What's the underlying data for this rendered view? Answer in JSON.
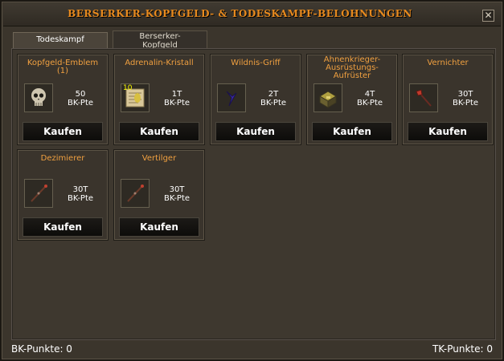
{
  "window": {
    "title": "BERSERKER-KOPFGELD- & TODESKAMPF-BELOHNUNGEN",
    "close_label": "✕"
  },
  "tabs": [
    {
      "label": "Todeskampf",
      "active": true
    },
    {
      "label": "Berserker-\nKopfgeld",
      "active": false
    }
  ],
  "items": [
    {
      "name": "Kopfgeld-Emblem\n(1)",
      "price": "50\nBK-Pte",
      "icon": "skull-icon",
      "button": "Kaufen"
    },
    {
      "name": "Adrenalin-Kristall",
      "price": "1T\nBK-Pte",
      "icon": "scroll-icon",
      "badge": "10",
      "button": "Kaufen"
    },
    {
      "name": "Wildnis-Griff",
      "price": "2T\nBK-Pte",
      "icon": "claw-icon",
      "button": "Kaufen"
    },
    {
      "name": "Ahnenkrieger-\nAusrüstungs-\nAufrüster",
      "price": "4T\nBK-Pte",
      "icon": "chest-icon",
      "button": "Kaufen"
    },
    {
      "name": "Vernichter",
      "price": "30T\nBK-Pte",
      "icon": "axe-icon",
      "button": "Kaufen"
    },
    {
      "name": "Dezimierer",
      "price": "30T\nBK-Pte",
      "icon": "staff-icon",
      "button": "Kaufen"
    },
    {
      "name": "Vertilger",
      "price": "30T\nBK-Pte",
      "icon": "staff-icon",
      "button": "Kaufen"
    }
  ],
  "footer": {
    "left": "BK-Punkte: 0",
    "right": "TK-Punkte: 0"
  },
  "colors": {
    "title": "#e88a1e",
    "item_name": "#f0a040",
    "window_bg": "#3b352c"
  }
}
